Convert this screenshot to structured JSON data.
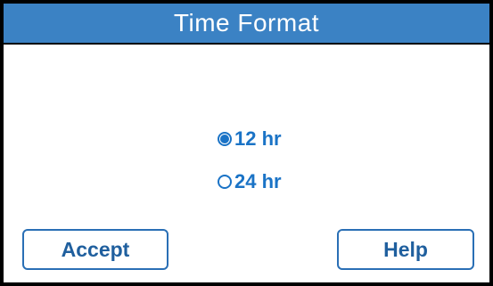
{
  "header": {
    "title": "Time Format"
  },
  "options": [
    {
      "label": "12 hr",
      "selected": true
    },
    {
      "label": "24 hr",
      "selected": false
    }
  ],
  "buttons": {
    "accept_label": "Accept",
    "help_label": "Help"
  },
  "colors": {
    "title_bar": "#3b82c4",
    "accent_text": "#1a73c6",
    "button_border": "#2a6fb5",
    "button_text": "#1f5f9e",
    "background": "#ffffff",
    "bezel": "#000000"
  },
  "icons": {
    "selected": "radio-selected-icon",
    "unselected": "radio-unselected-icon"
  }
}
